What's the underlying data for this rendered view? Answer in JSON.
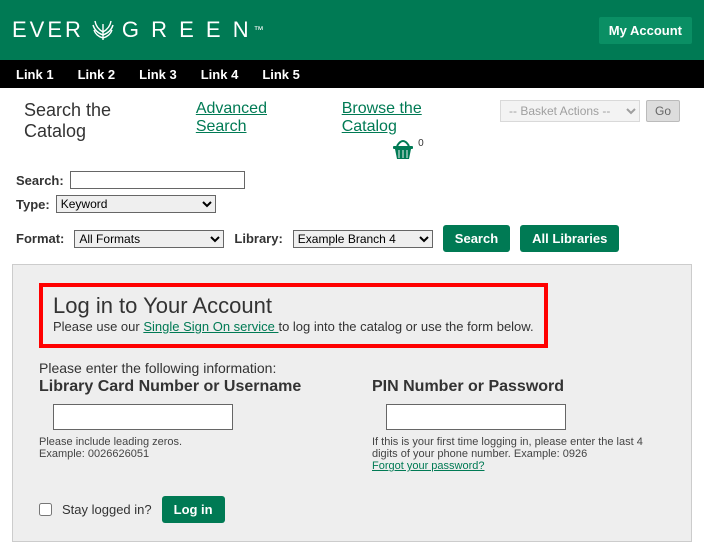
{
  "header": {
    "logo_left": "EVER",
    "logo_right": "G R E E N",
    "my_account": "My Account"
  },
  "nav": [
    "Link 1",
    "Link 2",
    "Link 3",
    "Link 4",
    "Link 5"
  ],
  "searchbar": {
    "title": "Search the Catalog",
    "advanced": "Advanced Search",
    "browse": "Browse the Catalog",
    "basket_count": "0",
    "basket_select": "-- Basket Actions --",
    "go": "Go"
  },
  "search_row1": {
    "search_label": "Search:",
    "type_label": "Type:",
    "type_value": "Keyword"
  },
  "search_row2": {
    "format_label": "Format:",
    "format_value": "All Formats",
    "library_label": "Library:",
    "library_value": "Example Branch 4",
    "search_btn": "Search",
    "all_btn": "All Libraries"
  },
  "login": {
    "title": "Log in to Your Account",
    "sub_pre": "Please use our ",
    "sub_link": "Single Sign On service ",
    "sub_post": "to log into the catalog or use the form below.",
    "intro": "Please enter the following information:",
    "left_label": "Library Card Number or Username",
    "left_hint1": "Please include leading zeros.",
    "left_hint2": "Example: 0026626051",
    "right_label": "PIN Number or Password",
    "right_hint1": "If this is your first time logging in, please enter the last 4 digits of your phone number. Example: 0926",
    "right_link": "Forgot your password?",
    "stay": "Stay logged in?",
    "login_btn": "Log in"
  }
}
